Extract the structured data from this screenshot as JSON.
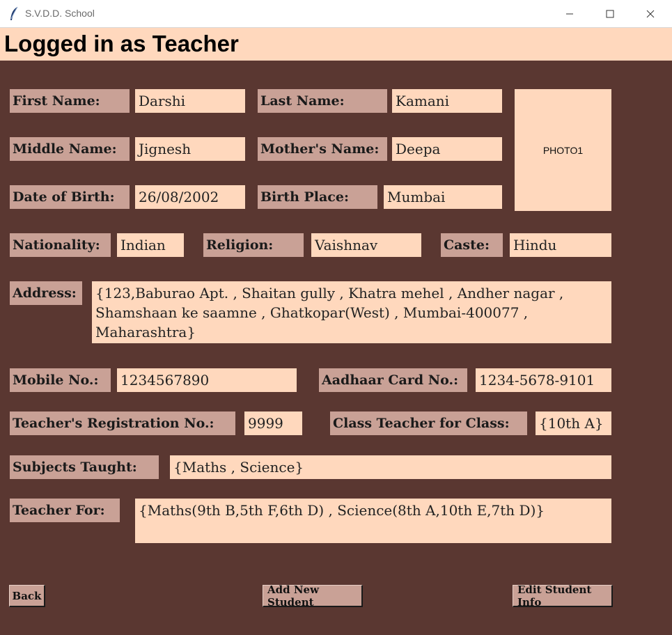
{
  "window": {
    "title": "S.V.D.D. School"
  },
  "header": {
    "title": "Logged in as Teacher"
  },
  "photo": {
    "label": "PHOTO1"
  },
  "fields": {
    "first_name": {
      "label": "First Name:",
      "value": "Darshi"
    },
    "last_name": {
      "label": "Last Name:",
      "value": "Kamani"
    },
    "middle_name": {
      "label": "Middle Name:",
      "value": "Jignesh"
    },
    "mother_name": {
      "label": "Mother's Name:",
      "value": "Deepa"
    },
    "dob": {
      "label": "Date of Birth:",
      "value": "26/08/2002"
    },
    "birth_place": {
      "label": "Birth Place:",
      "value": "Mumbai"
    },
    "nationality": {
      "label": "Nationality:",
      "value": "Indian"
    },
    "religion": {
      "label": "Religion:",
      "value": "Vaishnav"
    },
    "caste": {
      "label": "Caste:",
      "value": "Hindu"
    },
    "address": {
      "label": "Address:",
      "value": "{123,Baburao Apt. , Shaitan gully , Khatra mehel , Andher nagar , Shamshaan ke saamne , Ghatkopar(West) , Mumbai-400077 , Maharashtra}"
    },
    "mobile": {
      "label": "Mobile No.:",
      "value": "1234567890"
    },
    "aadhaar": {
      "label": "Aadhaar Card No.:",
      "value": "1234-5678-9101"
    },
    "registration": {
      "label": "Teacher's Registration No.:",
      "value": "9999"
    },
    "class_teacher": {
      "label": "Class Teacher for Class:",
      "value": "{10th A}"
    },
    "subjects": {
      "label": "Subjects Taught:",
      "value": "{Maths , Science}"
    },
    "teacher_for": {
      "label": "Teacher For:",
      "value": "{Maths(9th B,5th F,6th D) , Science(8th A,10th E,7th D)}"
    }
  },
  "buttons": {
    "back": "Back",
    "add_student": "Add New Student",
    "edit_student": "Edit Student Info"
  },
  "colors": {
    "background": "#5a3731",
    "label_bg": "#c9a196",
    "value_bg": "#ffd8bd"
  },
  "icons": {
    "app": "feather-icon",
    "minimize": "minimize-icon",
    "maximize": "maximize-icon",
    "close": "close-icon"
  }
}
